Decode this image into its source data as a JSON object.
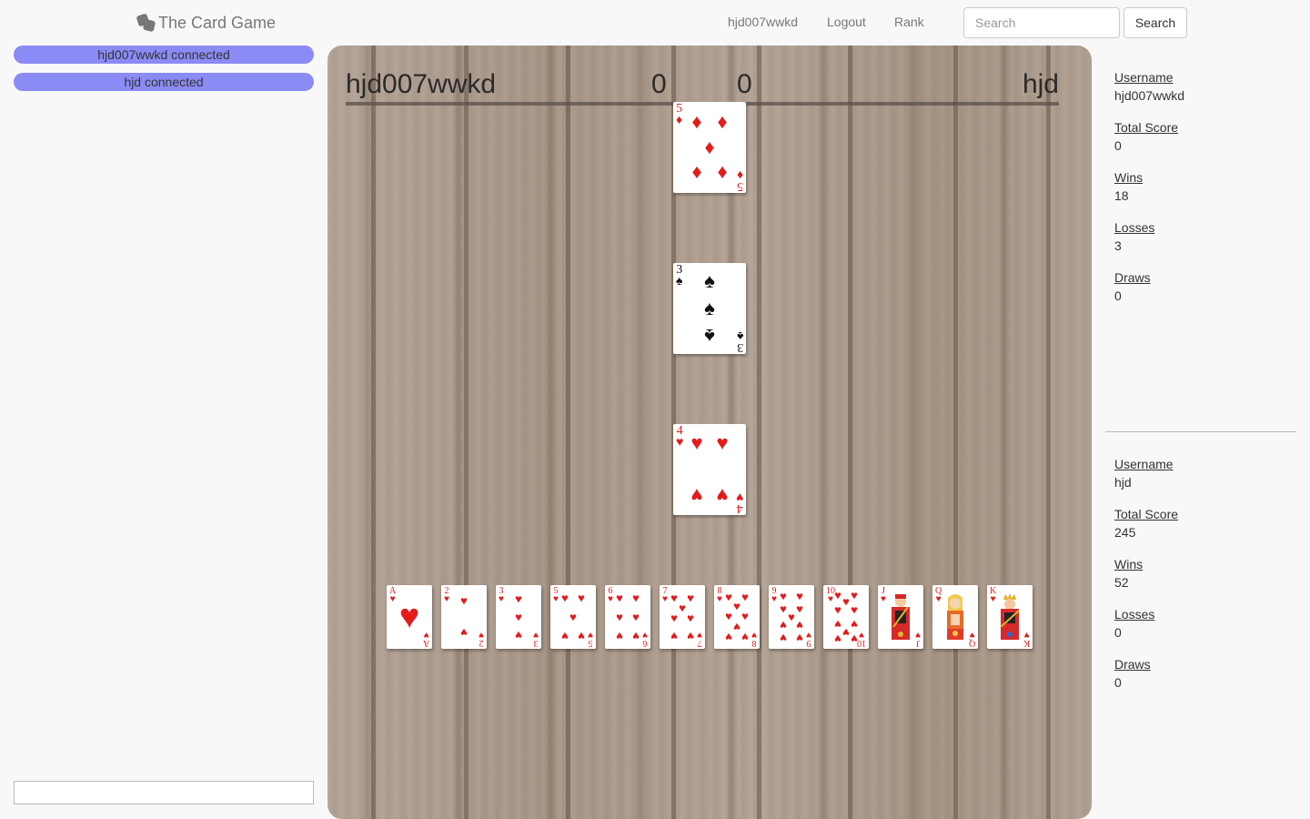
{
  "navbar": {
    "brand": "The Card Game",
    "brand_icon": "dice-icon",
    "user_link": "hjd007wwkd",
    "logout_link": "Logout",
    "rank_link": "Rank",
    "search_placeholder": "Search",
    "search_button": "Search"
  },
  "sidebar": {
    "statuses": [
      "hjd007wwkd connected",
      "hjd connected"
    ],
    "status_color": "#8b8bf6",
    "chat_input_value": ""
  },
  "board": {
    "player_left": "hjd007wwkd",
    "score_left": "0",
    "score_right": "0",
    "player_right": "hjd",
    "played_cards": [
      {
        "rank": "5",
        "suit": "♦",
        "color": "red"
      },
      {
        "rank": "3",
        "suit": "♠",
        "color": "black"
      },
      {
        "rank": "4",
        "suit": "♥",
        "color": "red"
      }
    ],
    "hand": [
      {
        "rank": "A",
        "suit": "♥"
      },
      {
        "rank": "2",
        "suit": "♥"
      },
      {
        "rank": "3",
        "suit": "♥"
      },
      {
        "rank": "5",
        "suit": "♥"
      },
      {
        "rank": "6",
        "suit": "♥"
      },
      {
        "rank": "7",
        "suit": "♥"
      },
      {
        "rank": "8",
        "suit": "♥"
      },
      {
        "rank": "9",
        "suit": "♥"
      },
      {
        "rank": "10",
        "suit": "♥"
      },
      {
        "rank": "J",
        "suit": "♥"
      },
      {
        "rank": "Q",
        "suit": "♥"
      },
      {
        "rank": "K",
        "suit": "♥"
      }
    ]
  },
  "players": [
    {
      "username_label": "Username",
      "username": "hjd007wwkd",
      "score_label": "Total Score",
      "score": "0",
      "wins_label": "Wins",
      "wins": "18",
      "losses_label": "Losses",
      "losses": "3",
      "draws_label": "Draws",
      "draws": "0"
    },
    {
      "username_label": "Username",
      "username": "hjd",
      "score_label": "Total Score",
      "score": "245",
      "wins_label": "Wins",
      "wins": "52",
      "losses_label": "Losses",
      "losses": "0",
      "draws_label": "Draws",
      "draws": "0"
    }
  ]
}
